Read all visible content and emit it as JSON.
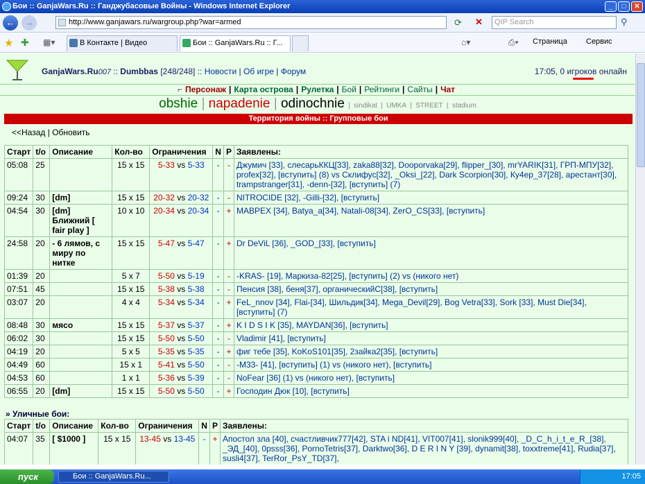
{
  "window": {
    "title": "Бои :: GanjaWars.Ru :: Ганджубасовые Войны - Windows Internet Explorer",
    "minimize": "_",
    "maximize": "□",
    "close": "✕"
  },
  "browser": {
    "url": "http://www.ganjawars.ru/wargroup.php?war=armed",
    "search_placeholder": "QIP Search",
    "tabs": [
      "В Контакте | Видео",
      "Бои :: GanjaWars.Ru :: Г..."
    ],
    "tools": {
      "page": "Страница",
      "service": "Сервис"
    }
  },
  "site": {
    "logo_text": "GanjaWars.Ru",
    "logo_sub": "007",
    "user": "Dumbbas",
    "user_hp": "[248/248]",
    "nav": [
      "Новости",
      "Об игре",
      "Форум"
    ],
    "time": "17:05,",
    "online": "0 игроков онлайн",
    "menu": [
      "Персонаж",
      "Карта острова",
      "Рулетка",
      "Бой",
      "Рейтинги",
      "Сайты",
      "Чат"
    ],
    "categories": {
      "obshie": "obshie",
      "napadenie": "napadenie",
      "odinochnie": "odinochnie",
      "small": [
        "sindikat",
        "UMKA",
        "STREET",
        "stadium"
      ]
    },
    "banner": "Территория войны :: Групповые бои",
    "back": "<<Назад",
    "refresh": "Обновить"
  },
  "table_headers": [
    "Старт",
    "t/o",
    "Описание",
    "Кол-во",
    "Ограничения",
    "N",
    "P",
    "Заявлены:"
  ],
  "rows": [
    {
      "start": "05:08",
      "to": "25",
      "desc": "",
      "size": "15 x 15",
      "lo": "5-33",
      "hi": "5-33",
      "n": "-",
      "p": "-",
      "players": "Джумич [33], слесарьККЦ[33], zaka88[32], Dooporvaka[29], flipper_[30], mrYARIK[31], ГРП-МПУ[32], profex[32], [вступить] (8) vs Склифус[32], _Oksi_[22], Dark Scorpion[30], Ку4ер_37[28], арестант[30], trampstranger[31], -denn-[32], [вступить] (7)"
    },
    {
      "start": "09:24",
      "to": "30",
      "desc": "[dm]",
      "size": "15 x 15",
      "lo": "20-32",
      "hi": "20-32",
      "n": "-",
      "p": "-",
      "players": "NITROCIDE [32], -Gilli-[32], [вступить]"
    },
    {
      "start": "04:54",
      "to": "30",
      "desc": "[dm] Ближний [ fair play ]",
      "size": "10 x 10",
      "lo": "20-34",
      "hi": "20-34",
      "n": "-",
      "p": "+",
      "players": "МАВРЕХ [34], Batya_a[34], Natali-08[34], ZerO_CS[33], [вступить]"
    },
    {
      "start": "24:58",
      "to": "20",
      "desc": "- 6 лямов, с миру по нитке",
      "size": "15 x 15",
      "lo": "5-47",
      "hi": "5-47",
      "n": "-",
      "p": "+",
      "players": "Dr DeViL [36], _GOD_[33], [вступить]"
    },
    {
      "start": "01:39",
      "to": "20",
      "desc": "",
      "size": "5 x 7",
      "lo": "5-50",
      "hi": "5-19",
      "n": "-",
      "p": "-",
      "players": "-KRAS- [19], Маркиза-82[25], [вступить] (2) vs (никого нет)"
    },
    {
      "start": "07:51",
      "to": "45",
      "desc": "",
      "size": "15 x 15",
      "lo": "5-38",
      "hi": "5-38",
      "n": "-",
      "p": "-",
      "players": "Пенсия [38], беня[37], органическийС[38], [вступить]"
    },
    {
      "start": "03:07",
      "to": "20",
      "desc": "",
      "size": "4 x 4",
      "lo": "5-34",
      "hi": "5-34",
      "n": "-",
      "p": "+",
      "players": "FeL_nnov [34], Flai-[34], Шильдик[34], Mega_Devil[29], Bog Vetra[33], Sork [33], Must Die[34], [вступить] (7)"
    },
    {
      "start": "08:48",
      "to": "30",
      "desc": "мясо",
      "size": "15 x 15",
      "lo": "5-37",
      "hi": "5-37",
      "n": "-",
      "p": "+",
      "players": "K I D S I K [35], MAYDAN[36], [вступить]"
    },
    {
      "start": "06:02",
      "to": "30",
      "desc": "",
      "size": "15 x 15",
      "lo": "5-50",
      "hi": "5-50",
      "n": "-",
      "p": "-",
      "players": "Vladimir [41], [вступить]"
    },
    {
      "start": "04:19",
      "to": "20",
      "desc": "",
      "size": "5 x 5",
      "lo": "5-35",
      "hi": "5-35",
      "n": "-",
      "p": "+",
      "players": "фиг тебе [35], KoKoS101[35], 2зайка2[35], [вступить]"
    },
    {
      "start": "04:49",
      "to": "60",
      "desc": "",
      "size": "15 x 1",
      "lo": "5-41",
      "hi": "5-50",
      "n": "-",
      "p": "-",
      "players": "-M33- [41], [вступить] (1) vs (никого нет), [вступить]"
    },
    {
      "start": "04:53",
      "to": "60",
      "desc": "",
      "size": "1 x 1",
      "lo": "5-36",
      "hi": "5-39",
      "n": "-",
      "p": "-",
      "players": "NoFear [36] (1) vs (никого нет), [вступить]"
    },
    {
      "start": "06:55",
      "to": "20",
      "desc": "[dm]",
      "size": "15 x 15",
      "lo": "5-50",
      "hi": "5-50",
      "n": "-",
      "p": "+",
      "players": "Господин Дюк [10], [вступить]"
    }
  ],
  "street": {
    "title": "» Уличные бои:",
    "headers": [
      "Старт",
      "t/o",
      "Описание",
      "Кол-во",
      "Ограничения",
      "N",
      "P",
      "Заявлены:"
    ],
    "rows": [
      {
        "start": "04:07",
        "to": "35",
        "desc": "[ $1000 ]",
        "size": "15 x 15",
        "lo": "13-45",
        "hi": "13-45",
        "n": "-",
        "p": "+",
        "players": "Апостол зла [40], счастливчик777[42], STA i ND[41], VIT007[41], slonik999[40], _D_C_h_i_t_e_R_[38], _ЭД_[40], 0psss[36], PornoTetris[37], Darktwo[36], D E R I N Y [39], dynamit[38], toxxtreme[41], Rudia[37], susli4[37], TerRor_PsY_TD[37],"
      }
    ]
  },
  "taskbar": {
    "start": "пуск",
    "task": "Бои :: GanjaWars.Ru...",
    "clock": "17:05"
  }
}
